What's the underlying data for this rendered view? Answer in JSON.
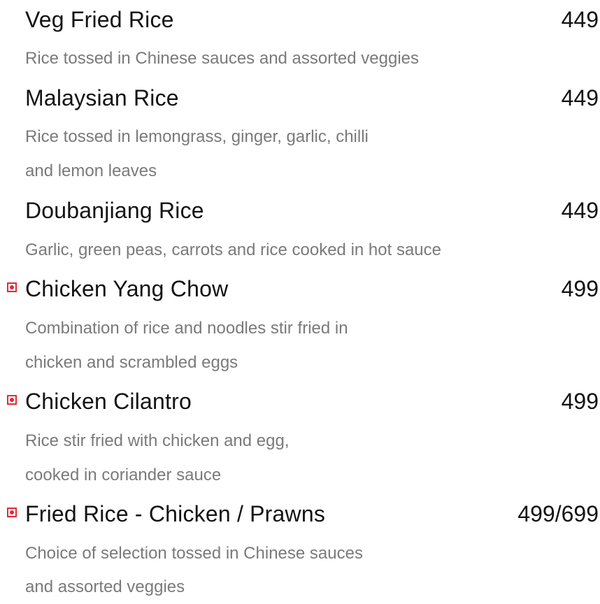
{
  "items": [
    {
      "name": "Veg Fried Rice",
      "price": "449",
      "non_veg": false,
      "desc_lines": [
        "Rice tossed in Chinese sauces and assorted veggies"
      ]
    },
    {
      "name": "Malaysian Rice",
      "price": "449",
      "non_veg": false,
      "desc_lines": [
        "Rice tossed in lemongrass, ginger, garlic, chilli",
        "and lemon leaves"
      ]
    },
    {
      "name": "Doubanjiang Rice",
      "price": "449",
      "non_veg": false,
      "desc_lines": [
        "Garlic, green peas, carrots  and rice cooked in hot sauce"
      ]
    },
    {
      "name": "Chicken Yang Chow",
      "price": "499",
      "non_veg": true,
      "desc_lines": [
        "Combination of rice and noodles stir fried in",
        "chicken and scrambled eggs"
      ]
    },
    {
      "name": "Chicken Cilantro",
      "price": "499",
      "non_veg": true,
      "desc_lines": [
        "Rice stir fried with chicken and egg,",
        "cooked in coriander sauce"
      ]
    },
    {
      "name": "Fried Rice - Chicken / Prawns",
      "price": "499/699",
      "non_veg": true,
      "desc_lines": [
        "Choice of selection tossed in Chinese sauces",
        "and assorted veggies"
      ]
    }
  ],
  "colors": {
    "title": "#121212",
    "description": "#7a7a7a",
    "non_veg_marker": "#e02b35"
  },
  "icons": {
    "non_veg": "non-veg-marker-icon"
  }
}
